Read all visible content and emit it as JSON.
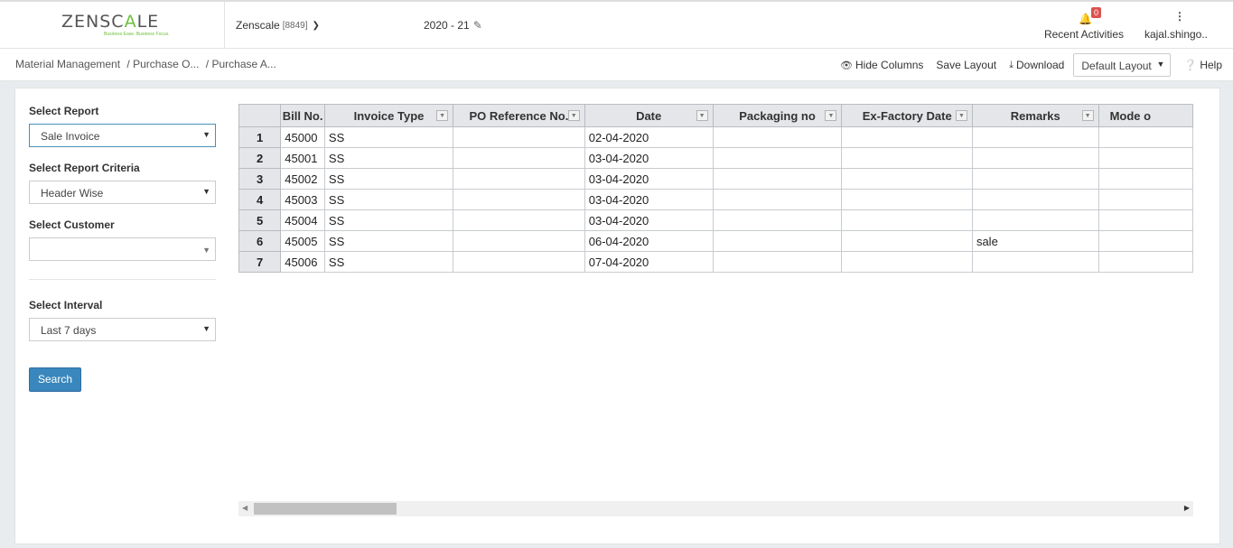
{
  "header": {
    "logo_left": "ZENSC",
    "logo_mark": "A",
    "logo_right": "LE",
    "logo_tagline": "Business Ease. Business Focus.",
    "company_name": "Zenscale",
    "company_code": "[8849]",
    "financial_year": "2020 - 21",
    "notification_count": "0",
    "recent_activities_label": "Recent Activities",
    "user_label": "kajal.shingo.."
  },
  "breadcrumb": [
    "Material Management",
    "/ Purchase O...",
    "/ Purchase A..."
  ],
  "toolbar": {
    "hide_columns": "Hide Columns",
    "save_layout": "Save Layout",
    "download": "Download",
    "layout_value": "Default Layout",
    "help": "Help"
  },
  "filters": {
    "report_label": "Select Report",
    "report_value": "Sale Invoice",
    "criteria_label": "Select Report Criteria",
    "criteria_value": "Header Wise",
    "customer_label": "Select Customer",
    "customer_value": "",
    "interval_label": "Select Interval",
    "interval_value": "Last 7 days",
    "search_label": "Search"
  },
  "grid": {
    "columns": [
      "Bill No.",
      "Invoice Type",
      "PO Reference No.",
      "Date",
      "Packaging no",
      "Ex-Factory Date",
      "Remarks",
      "Mode o"
    ],
    "rows": [
      {
        "n": "1",
        "bill": "45000",
        "type": "SS",
        "po": "",
        "date": "02-04-2020",
        "pack": "",
        "exf": "",
        "remarks": "",
        "mode": ""
      },
      {
        "n": "2",
        "bill": "45001",
        "type": "SS",
        "po": "",
        "date": "03-04-2020",
        "pack": "",
        "exf": "",
        "remarks": "",
        "mode": ""
      },
      {
        "n": "3",
        "bill": "45002",
        "type": "SS",
        "po": "",
        "date": "03-04-2020",
        "pack": "",
        "exf": "",
        "remarks": "",
        "mode": ""
      },
      {
        "n": "4",
        "bill": "45003",
        "type": "SS",
        "po": "",
        "date": "03-04-2020",
        "pack": "",
        "exf": "",
        "remarks": "",
        "mode": ""
      },
      {
        "n": "5",
        "bill": "45004",
        "type": "SS",
        "po": "",
        "date": "03-04-2020",
        "pack": "",
        "exf": "",
        "remarks": "",
        "mode": ""
      },
      {
        "n": "6",
        "bill": "45005",
        "type": "SS",
        "po": "",
        "date": "06-04-2020",
        "pack": "",
        "exf": "",
        "remarks": "sale",
        "mode": ""
      },
      {
        "n": "7",
        "bill": "45006",
        "type": "SS",
        "po": "",
        "date": "07-04-2020",
        "pack": "",
        "exf": "",
        "remarks": "",
        "mode": ""
      }
    ]
  },
  "colors": {
    "accent": "#3a87bd",
    "logo_green": "#6cbf3b",
    "badge": "#d9534f"
  },
  "icons": [
    "bell-icon",
    "more-vertical-icon",
    "edit-icon",
    "eye-slash-icon",
    "download-icon",
    "question-circle-icon",
    "chevron-down-icon",
    "filter-icon"
  ]
}
